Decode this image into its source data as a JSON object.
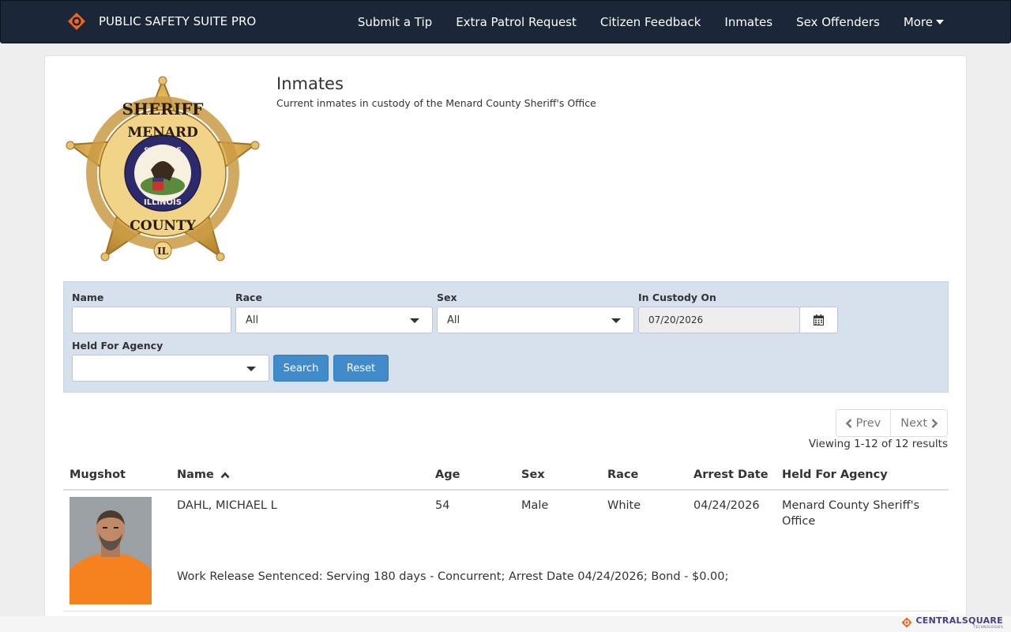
{
  "nav": {
    "brand": "PUBLIC SAFETY SUITE PRO",
    "items": [
      {
        "label": "Submit a Tip"
      },
      {
        "label": "Extra Patrol Request"
      },
      {
        "label": "Citizen Feedback"
      },
      {
        "label": "Inmates"
      },
      {
        "label": "Sex Offenders"
      },
      {
        "label": "More"
      }
    ]
  },
  "header": {
    "title": "Inmates",
    "subtitle": "Current inmates in custody of the Menard County Sheriff's Office"
  },
  "badge": {
    "top_text": "SHERIFF",
    "county": "MENARD",
    "state_of": "STATE OF",
    "state": "ILLINOIS",
    "bottom_text": "COUNTY",
    "abbrev": "IL"
  },
  "filters": {
    "name_label": "Name",
    "name_value": "",
    "race_label": "Race",
    "race_value": "All",
    "sex_label": "Sex",
    "sex_value": "All",
    "custody_label": "In Custody On",
    "custody_value": "07/20/2026",
    "agency_label": "Held For Agency",
    "agency_value": "",
    "search_label": "Search",
    "reset_label": "Reset"
  },
  "pager": {
    "prev": "Prev",
    "next": "Next",
    "results": "Viewing 1-12 of 12 results"
  },
  "table": {
    "columns": [
      "Mugshot",
      "Name",
      "Age",
      "Sex",
      "Race",
      "Arrest Date",
      "Held For Agency"
    ],
    "rows": [
      {
        "name": "DAHL, MICHAEL L",
        "age": "54",
        "sex": "Male",
        "race": "White",
        "arrest_date": "04/24/2026",
        "agency": "Menard County Sheriff's Office",
        "notes": "Work Release Sentenced: Serving 180 days - Concurrent; Arrest Date 04/24/2026; Bond - $0.00;"
      }
    ]
  },
  "footer": {
    "brand": "CENTRALSQUARE",
    "sub": "TECHNOLOGIES"
  },
  "colors": {
    "navbar": "#1b2638",
    "accent": "#428bca",
    "filter_panel": "#d6e1ed",
    "brand_orange": "#f26522"
  },
  "icons": [
    "brand-logo-icon",
    "caret-down-icon",
    "calendar-icon",
    "chevron-left-icon",
    "chevron-right-icon",
    "sort-up-icon",
    "sheriff-badge"
  ]
}
